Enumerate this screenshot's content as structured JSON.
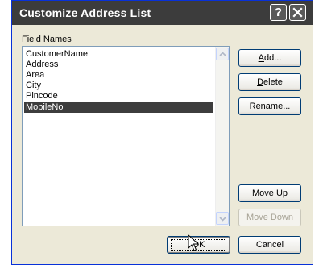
{
  "window": {
    "title": "Customize Address List"
  },
  "titlebar_buttons": {
    "help": "?"
  },
  "field_names": {
    "label_mnemonic": "F",
    "label_rest": "ield Names",
    "items": [
      "CustomerName",
      "Address",
      "Area",
      "City",
      "Pincode",
      "MobileNo"
    ],
    "selected_index": 5
  },
  "buttons": {
    "add": {
      "mnemonic": "A",
      "rest": "dd..."
    },
    "delete": {
      "mnemonic": "D",
      "rest": "elete"
    },
    "rename": {
      "mnemonic": "R",
      "rest": "ename..."
    },
    "move_up": {
      "pre": "Move ",
      "mnemonic": "U",
      "rest": "p"
    },
    "move_down": {
      "label": "Move Down"
    },
    "ok": {
      "label": "OK"
    },
    "cancel": {
      "label": "Cancel"
    }
  }
}
